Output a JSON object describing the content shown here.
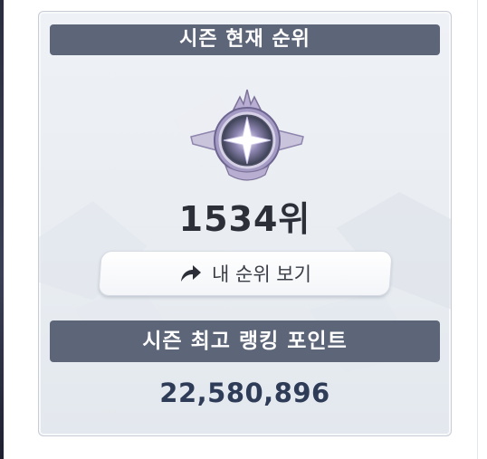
{
  "season_rank": {
    "header": "시즌 현재 순위",
    "rank": "1534위",
    "emblem_icon": "star-crest-emblem",
    "my_rank_button": {
      "label": "내 순위 보기",
      "icon": "share-arrow-icon"
    }
  },
  "season_points": {
    "header": "시즌 최고 랭킹 포인트",
    "value": "22,580,896"
  },
  "colors": {
    "header_bg": "#5d6578",
    "panel_bg": "#eef1f5",
    "points_text": "#2f3c57",
    "rank_text": "#2c2f38"
  }
}
